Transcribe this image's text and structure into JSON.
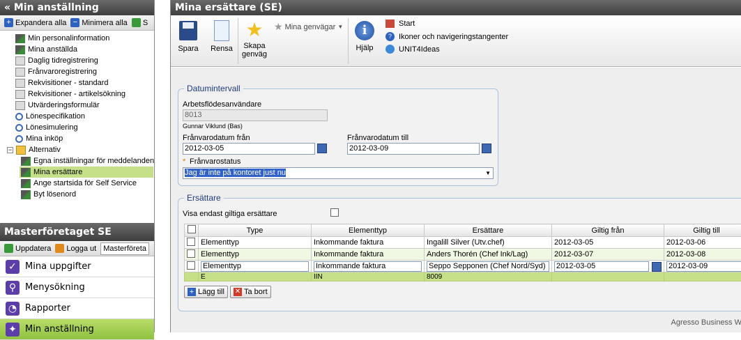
{
  "left": {
    "title": "« Min anställning",
    "toolbar": {
      "expand_all": "Expandera alla",
      "minimize_all": "Minimera alla",
      "start_trunc": "S"
    },
    "tree": [
      "Min personalinformation",
      "Mina anställda",
      "Daglig tidregistrering",
      "Frånvaroregistrering",
      "Rekvisitioner - standard",
      "Rekvisitioner - artikelsökning",
      "Utvärderingsformulär",
      "Lönespecifikation",
      "Lönesimulering",
      "Mina inköp"
    ],
    "folder": "Alternativ",
    "subtree": [
      "Egna inställningar för meddelanden",
      "Mina ersättare",
      "Ange startsida för Self Service",
      "Byt lösenord"
    ],
    "company_title": "Masterföretaget SE",
    "company_toolbar": {
      "update": "Uppdatera",
      "logout": "Logga ut",
      "company": "Masterföreta"
    },
    "nav": [
      "Mina uppgifter",
      "Menysökning",
      "Rapporter",
      "Min anställning"
    ]
  },
  "right": {
    "title": "Mina ersättare (SE)",
    "ribbon": {
      "save": "Spara",
      "clear": "Rensa",
      "create_shortcut_1": "Skapa",
      "create_shortcut_2": "genväg",
      "my_shortcuts": "Mina genvägar",
      "help": "Hjälp",
      "link_start": "Start",
      "link_icons": "Ikoner och navigeringstangenter",
      "link_ideas": "UNIT4Ideas"
    },
    "date_section": {
      "legend": "Datumintervall",
      "workflow_user_label": "Arbetsflödesanvändare",
      "workflow_user_value": "8013",
      "workflow_user_name": "Gunnar Viklund (Bas)",
      "from_label": "Frånvarodatum från",
      "from_value": "2012-03-05",
      "to_label": "Frånvarodatum till",
      "to_value": "2012-03-09",
      "status_required": "*",
      "status_label": "Frånvarostatus",
      "status_value": "Jag är inte på kontoret just nu"
    },
    "substitutes": {
      "legend": "Ersättare",
      "show_valid_label": "Visa endast giltiga ersättare",
      "columns": [
        "Type",
        "Elementtyp",
        "Ersättare",
        "Giltig från",
        "Giltig till"
      ],
      "rows": [
        [
          "Elementtyp",
          "Inkommande faktura",
          "Ingalill Silver (Utv.chef)",
          "2012-03-05",
          "2012-03-06"
        ],
        [
          "Elementtyp",
          "Inkommande faktura",
          "Anders Thorén (Chef Ink/Lag)",
          "2012-03-07",
          "2012-03-08"
        ],
        [
          "Elementtyp",
          "Inkommande faktura",
          "Seppo Sepponen (Chef Nord/Syd)",
          "2012-03-05",
          "2012-03-09"
        ]
      ],
      "sub_row": [
        "E",
        "IIN",
        "8009"
      ],
      "add_button": "Lägg till",
      "remove_button": "Ta bort"
    },
    "footer": "Agresso Business W"
  }
}
